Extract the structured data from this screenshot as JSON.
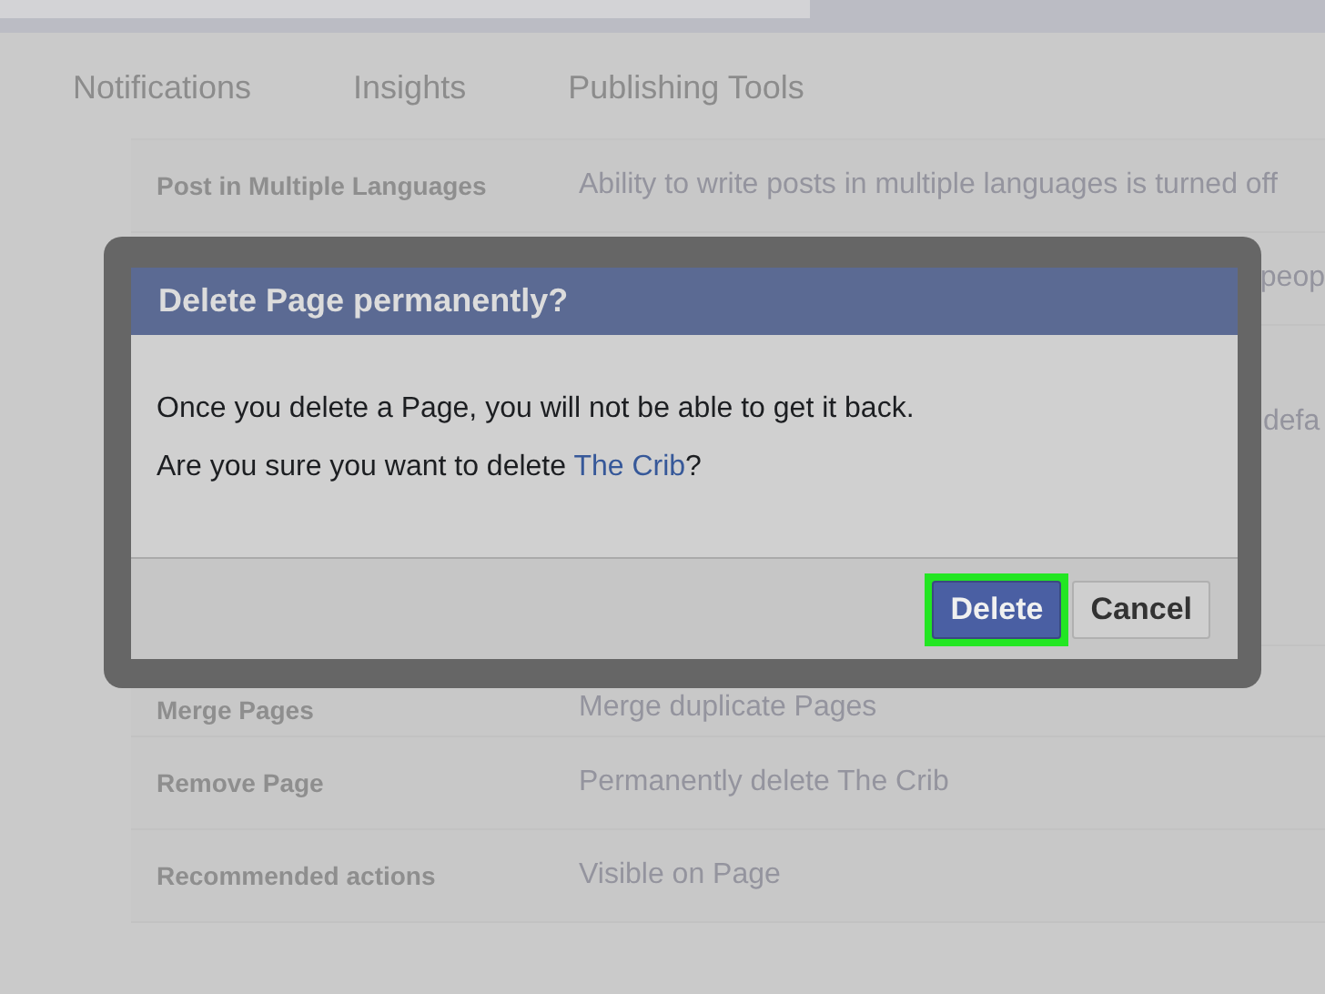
{
  "tabs": [
    {
      "label": "Notifications",
      "selected": false
    },
    {
      "label": "Insights",
      "selected": false
    },
    {
      "label": "Publishing Tools",
      "selected": false
    }
  ],
  "settings": [
    {
      "label": "Post in Multiple Languages",
      "value": "Ability to write posts in multiple languages is turned off"
    },
    {
      "value": "peop"
    },
    {
      "value": "defa"
    },
    {
      "label": "Merge Pages",
      "value": "Merge duplicate Pages"
    },
    {
      "label": "Remove Page",
      "value": "Permanently delete The Crib"
    },
    {
      "label": "Recommended actions",
      "value": "Visible on Page"
    }
  ],
  "dialog": {
    "title": "Delete Page permanently?",
    "message": "Once you delete a Page, you will not be able to get it back.",
    "question": "Are you sure you want to delete",
    "page_name": "The Crib",
    "question_end": "?",
    "buttons": [
      {
        "label": "Delete",
        "kind": "primary",
        "highlighted": true
      },
      {
        "label": "Cancel",
        "kind": "secondary",
        "highlighted": false
      }
    ]
  }
}
